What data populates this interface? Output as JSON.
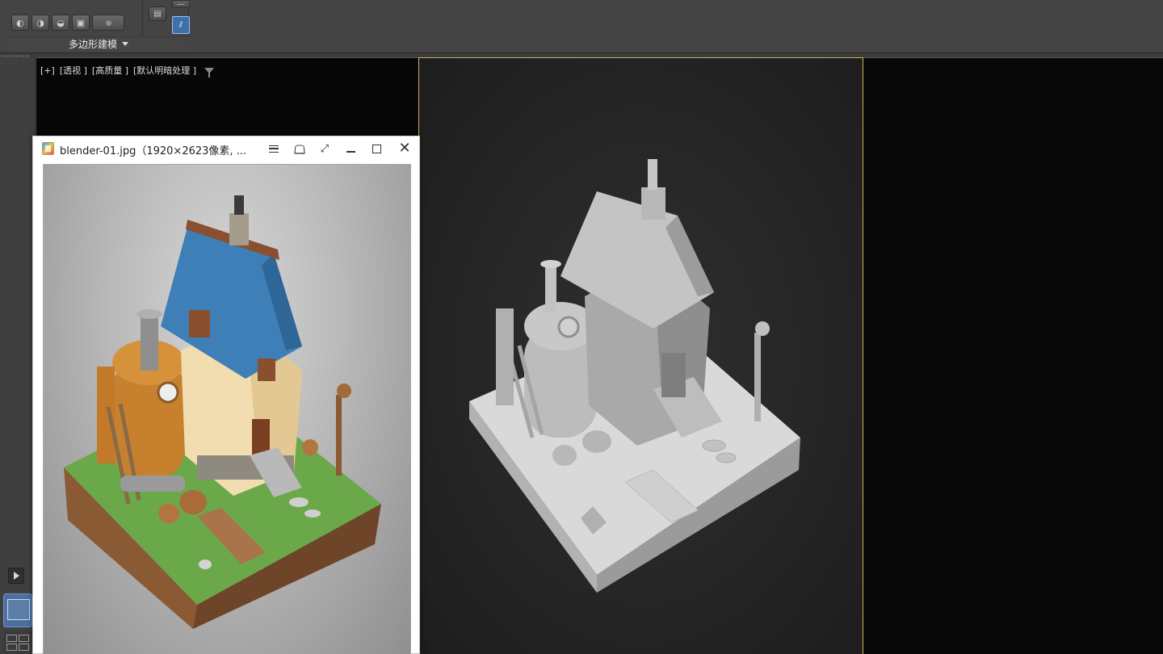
{
  "ribbon": {
    "group_label": "多边形建模"
  },
  "viewport_left": {
    "label_plus": "[+]",
    "label_view": "[透视 ]",
    "label_quality": "[高质量 ]",
    "label_shading": "[默认明暗处理 ]"
  },
  "viewer": {
    "title": "blender-01.jpg（1920×2623像素, ..."
  },
  "colors": {
    "active_viewport_border": "#c9b25a",
    "active_button": "#3d6fa8",
    "roof_blue": "#3f7fb8",
    "grass_green": "#6aa84a",
    "tank_orange": "#c7812e"
  }
}
